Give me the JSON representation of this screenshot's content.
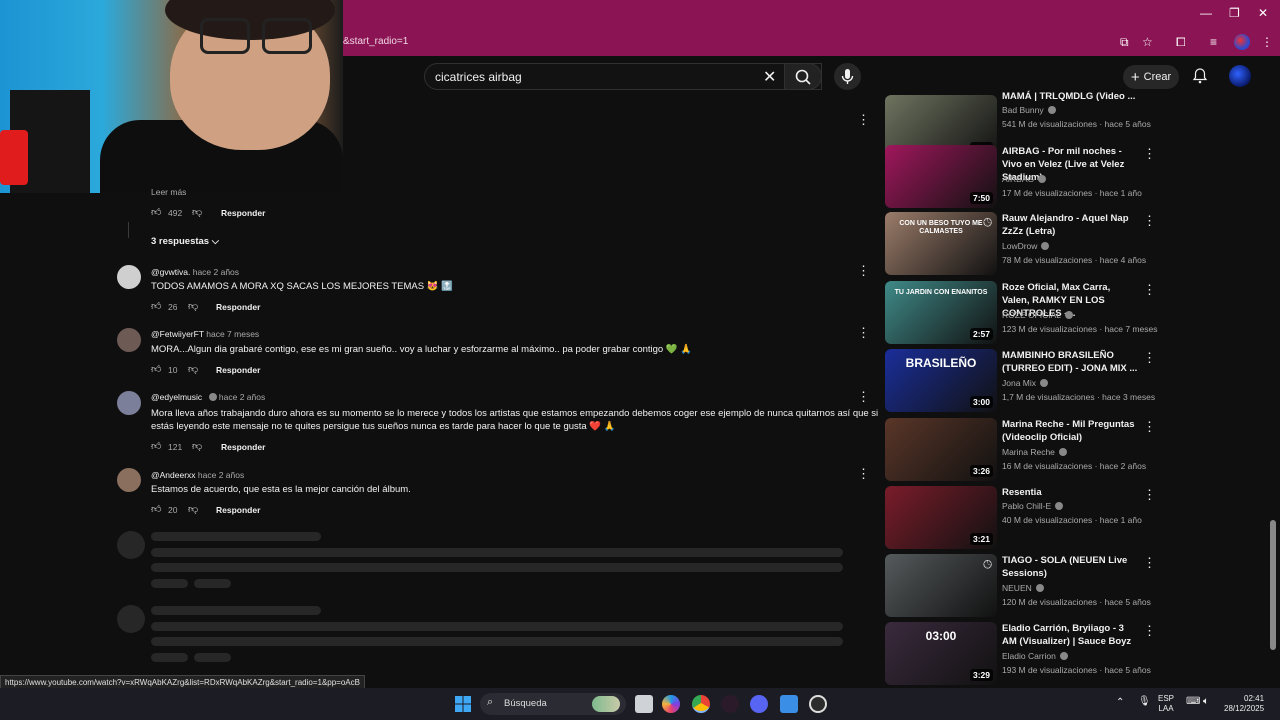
{
  "browser": {
    "url_fragment": "&start_radio=1",
    "status_url": "https://www.youtube.com/watch?v=xRWqAbKAZrg&list=RDxRWqAbKAZrg&start_radio=1&pp=oAcB"
  },
  "header": {
    "search_value": "cicatrices airbag",
    "create_label": "Crear"
  },
  "comments": {
    "first_thread": {
      "truncated_text": "Leer más",
      "likes": "492",
      "reply_label": "Responder",
      "replies_toggle": "3 respuestas"
    },
    "items": [
      {
        "author": "@gvwtiva.",
        "time": "hace 2 años",
        "text": "TODOS AMAMOS A MORA XQ SACAS LOS MEJORES TEMAS 😻 🔝",
        "likes": "26",
        "reply_label": "Responder"
      },
      {
        "author": "@FetwiiyerFT",
        "time": "hace 7 meses",
        "text": "MORA...Algun dia grabaré contigo, ese es mi gran sueño.. voy a luchar y esforzarme al máximo.. pa poder grabar contigo 💚 🙏",
        "likes": "10",
        "reply_label": "Responder"
      },
      {
        "author": "@edyelmusic",
        "time": "hace 2 años",
        "text_line1": "Mora  lleva años trabajando duro ahora es su momento se lo merece y todos los artistas que estamos empezando debemos coger ese ejemplo de nunca quitarnos así que si",
        "text_line2": "estás leyendo este mensaje no te quites persigue tus sueños nunca es tarde para hacer lo que te gusta  ❤️ 🙏",
        "likes": "121",
        "reply_label": "Responder"
      },
      {
        "author": "@Andeerxx",
        "time": "hace 2 años",
        "text": "Estamos de acuerdo, que esta es la mejor canción del álbum.",
        "likes": "20",
        "reply_label": "Responder"
      }
    ]
  },
  "recommendations": [
    {
      "title": "MAMÁ | TRLQMDLG (Video ...",
      "channel": "Bad Bunny",
      "meta": "541 M de visualizaciones · hace 5 años",
      "duration": "4:26",
      "thumb": "#6f7460"
    },
    {
      "title": "AIRBAG - Por mil noches - Vivo en Velez (Live at Velez Stadium)",
      "channel": "AIRBAG",
      "meta": "17 M de visualizaciones · hace 1 año",
      "duration": "7:50",
      "thumb": "#a0175c"
    },
    {
      "title": "Rauw Alejandro - Aquel Nap ZzZz (Letra)",
      "channel": "LowDrow",
      "meta": "78 M de visualizaciones · hace 4 años",
      "duration": "",
      "thumb": "#9b7c6a",
      "thumb_text": "CON UN BESO TUYO ME CALMASTES"
    },
    {
      "title": "Roze Oficial, Max Carra, Valen, RAMKY EN LOS CONTROLES -...",
      "channel": "ROZE OFICIAL",
      "meta": "123 M de visualizaciones · hace 7 meses",
      "duration": "2:57",
      "thumb": "#3f8a88",
      "thumb_text": "TU JARDIN CON ENANITOS"
    },
    {
      "title": "MAMBINHO BRASILEÑO (TURREO EDIT) - JONA MIX ...",
      "channel": "Jona Mix",
      "meta": "1,7 M de visualizaciones · hace 3 meses",
      "duration": "3:00",
      "thumb": "#1a2e9a",
      "thumb_text": "BRASILEÑO"
    },
    {
      "title": "Marina Reche - Mil Preguntas (Videoclip Oficial)",
      "channel": "Marina Reche",
      "meta": "16 M de visualizaciones · hace 2 años",
      "duration": "3:26",
      "thumb": "#5a3628"
    },
    {
      "title": "Resentia",
      "channel": "Pablo Chill-E",
      "meta": "40 M de visualizaciones · hace 1 año",
      "duration": "3:21",
      "thumb": "#7a1c2a"
    },
    {
      "title": "TIAGO - SOLA (NEUEN Live Sessions)",
      "channel": "NEUEN",
      "meta": "120 M de visualizaciones · hace 5 años",
      "duration": "",
      "thumb": "#555a5c"
    },
    {
      "title": "Eladio Carrión, Bryiiago - 3 AM (Visualizer) | Sauce Boyz",
      "channel": "Eladio Carrion",
      "meta": "193 M de visualizaciones · hace 5 años",
      "duration": "3:29",
      "thumb": "#3a2a3d",
      "thumb_text": "03:00"
    }
  ],
  "taskbar": {
    "search_label": "Búsqueda",
    "lang_line1": "ESP",
    "lang_line2": "LAA",
    "time": "02:41",
    "date": "28/12/2025"
  }
}
